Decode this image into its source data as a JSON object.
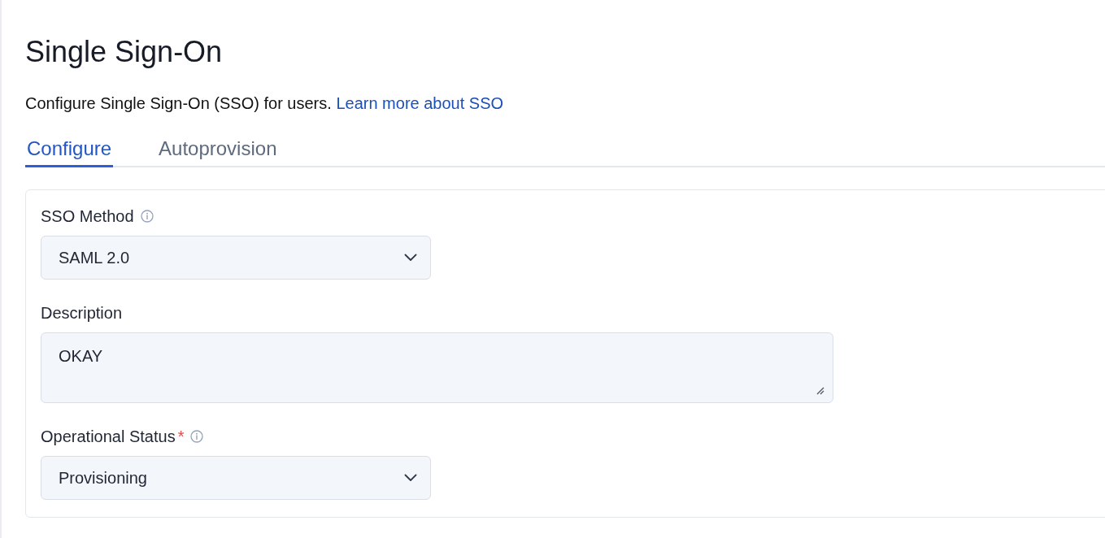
{
  "page": {
    "title": "Single Sign-On",
    "description": "Configure Single Sign-On (SSO) for users.",
    "link": "Learn more about SSO"
  },
  "tabs": [
    {
      "label": "Configure",
      "selected": true
    },
    {
      "label": "Autoprovision",
      "selected": false
    }
  ],
  "form": {
    "fields": [
      {
        "kind": "select",
        "label": "SSO Method",
        "info": true,
        "value": "SAML 2.0"
      },
      {
        "kind": "textarea",
        "label": "Description",
        "info": false,
        "value": "OKAY"
      },
      {
        "kind": "select",
        "label": "Operational Status",
        "required_mark": "*",
        "info": true,
        "value": "Provisioning"
      }
    ]
  }
}
